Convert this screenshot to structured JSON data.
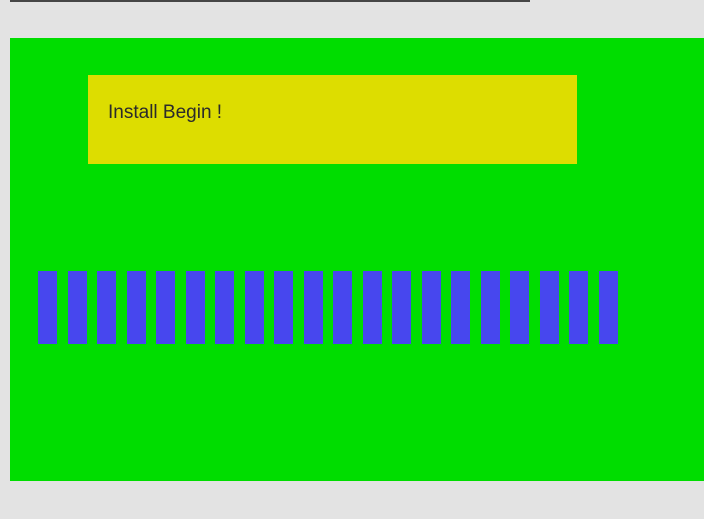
{
  "screen": {
    "message": "Install Begin !"
  },
  "progress": {
    "filled_blocks": 20,
    "color": "#4747ee"
  },
  "colors": {
    "background": "#e3e3e3",
    "panel": "#00dd00",
    "message_box": "#dddd00",
    "text": "#2b2b2b"
  }
}
